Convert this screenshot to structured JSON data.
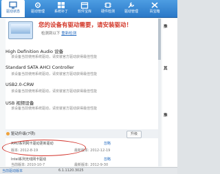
{
  "toolbar": {
    "buttons": [
      {
        "label": "驱动状态"
      },
      {
        "label": "驱动管理"
      },
      {
        "label": "系统补丁"
      },
      {
        "label": "软件宝库"
      },
      {
        "label": "硬件检测"
      },
      {
        "label": "驱动管理"
      },
      {
        "label": "百宝箱"
      }
    ]
  },
  "banner": {
    "headline": "您的设备有驱动需要，请安装驱动！",
    "subline_prefix": "检测到以下",
    "subline_link": "重新检测"
  },
  "devices": [
    {
      "title": "High Definition Audio 设备",
      "sub": "该设备当前使用系统驱动，请安装官方驱动获得最佳性能"
    },
    {
      "title": "Standard SATA AHCI Controller",
      "sub": "该设备当前使用系统驱动，请安装官方驱动获得最佳性能"
    },
    {
      "title": "USB2.0-CRW",
      "sub": "该设备当前使用系统驱动，请安装官方驱动获得最佳性能"
    },
    {
      "title": "USB 视频设备",
      "sub": "该设备当前使用系统驱动，请安装官方驱动获得最佳性能"
    }
  ],
  "upgrade_group": {
    "title": "驱动升级(7项)",
    "button": "升级"
  },
  "drivers": [
    {
      "name": "AMD系列网卡驱动更新驱动",
      "version": "版本: 2012-8-19",
      "new_version": "最新版本: 2012-12-19",
      "action": "忽略"
    },
    {
      "name": "Intel系列无线网卡驱动",
      "version": "当前版本: 2010-10-7",
      "new_version": "最新版本: 2012-9-30",
      "action": "忽略"
    }
  ],
  "side": {
    "items": [
      "推",
      "其",
      "推"
    ]
  },
  "status": {
    "text": "当前驱动版本",
    "version": "6.1.1120.3025"
  }
}
